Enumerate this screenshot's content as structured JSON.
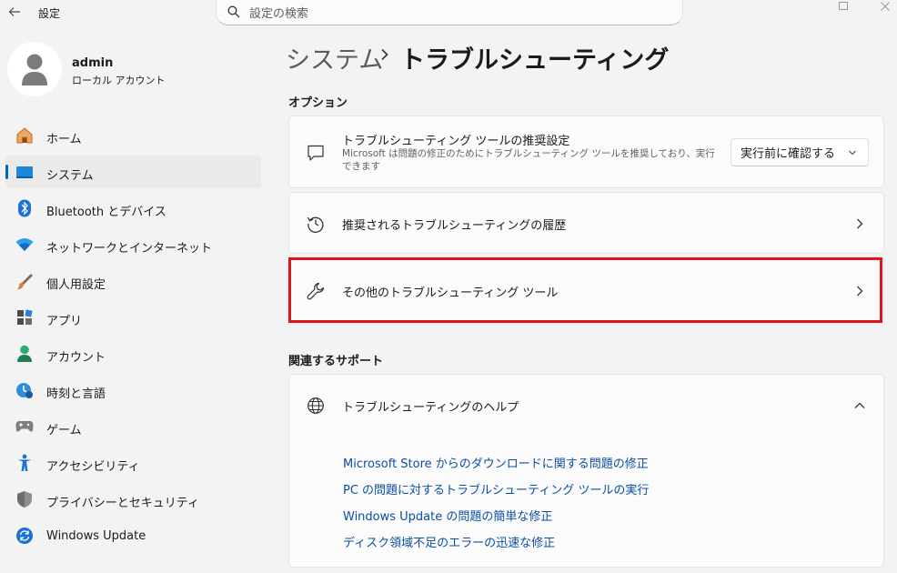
{
  "window": {
    "app_title": "設定",
    "search_placeholder": "設定の検索"
  },
  "profile": {
    "name": "admin",
    "account_type": "ローカル アカウント"
  },
  "nav": {
    "items": [
      {
        "label": "ホーム",
        "icon": "home-icon"
      },
      {
        "label": "システム",
        "icon": "system-icon",
        "active": true
      },
      {
        "label": "Bluetooth とデバイス",
        "icon": "bluetooth-icon"
      },
      {
        "label": "ネットワークとインターネット",
        "icon": "network-icon"
      },
      {
        "label": "個人用設定",
        "icon": "brush-icon"
      },
      {
        "label": "アプリ",
        "icon": "apps-icon"
      },
      {
        "label": "アカウント",
        "icon": "account-icon"
      },
      {
        "label": "時刻と言語",
        "icon": "time-language-icon"
      },
      {
        "label": "ゲーム",
        "icon": "gamepad-icon"
      },
      {
        "label": "アクセシビリティ",
        "icon": "accessibility-icon"
      },
      {
        "label": "プライバシーとセキュリティ",
        "icon": "shield-icon"
      },
      {
        "label": "Windows Update",
        "icon": "update-icon"
      }
    ]
  },
  "header": {
    "breadcrumb_root": "システム",
    "breadcrumb_current": "トラブルシューティング"
  },
  "options": {
    "title": "オプション",
    "recommended": {
      "title": "トラブルシューティング ツールの推奨設定",
      "description": "Microsoft は問題の修正のためにトラブルシューティング ツールを推奨しており、実行できます",
      "selected": "実行前に確認する"
    },
    "history": {
      "title": "推奨されるトラブルシューティングの履歴"
    },
    "other": {
      "title": "その他のトラブルシューティング ツール"
    }
  },
  "related": {
    "title": "関連するサポート",
    "help_title": "トラブルシューティングのヘルプ",
    "links": [
      "Microsoft Store からのダウンロードに関する問題の修正",
      "PC の問題に対するトラブルシューティング ツールの実行",
      "Windows Update の問題の簡単な修正",
      "ディスク領域不足のエラーの迅速な修正"
    ]
  },
  "colors": {
    "accent": "#0067c0",
    "link": "#0b4fa4",
    "highlight": "#e0141e"
  }
}
